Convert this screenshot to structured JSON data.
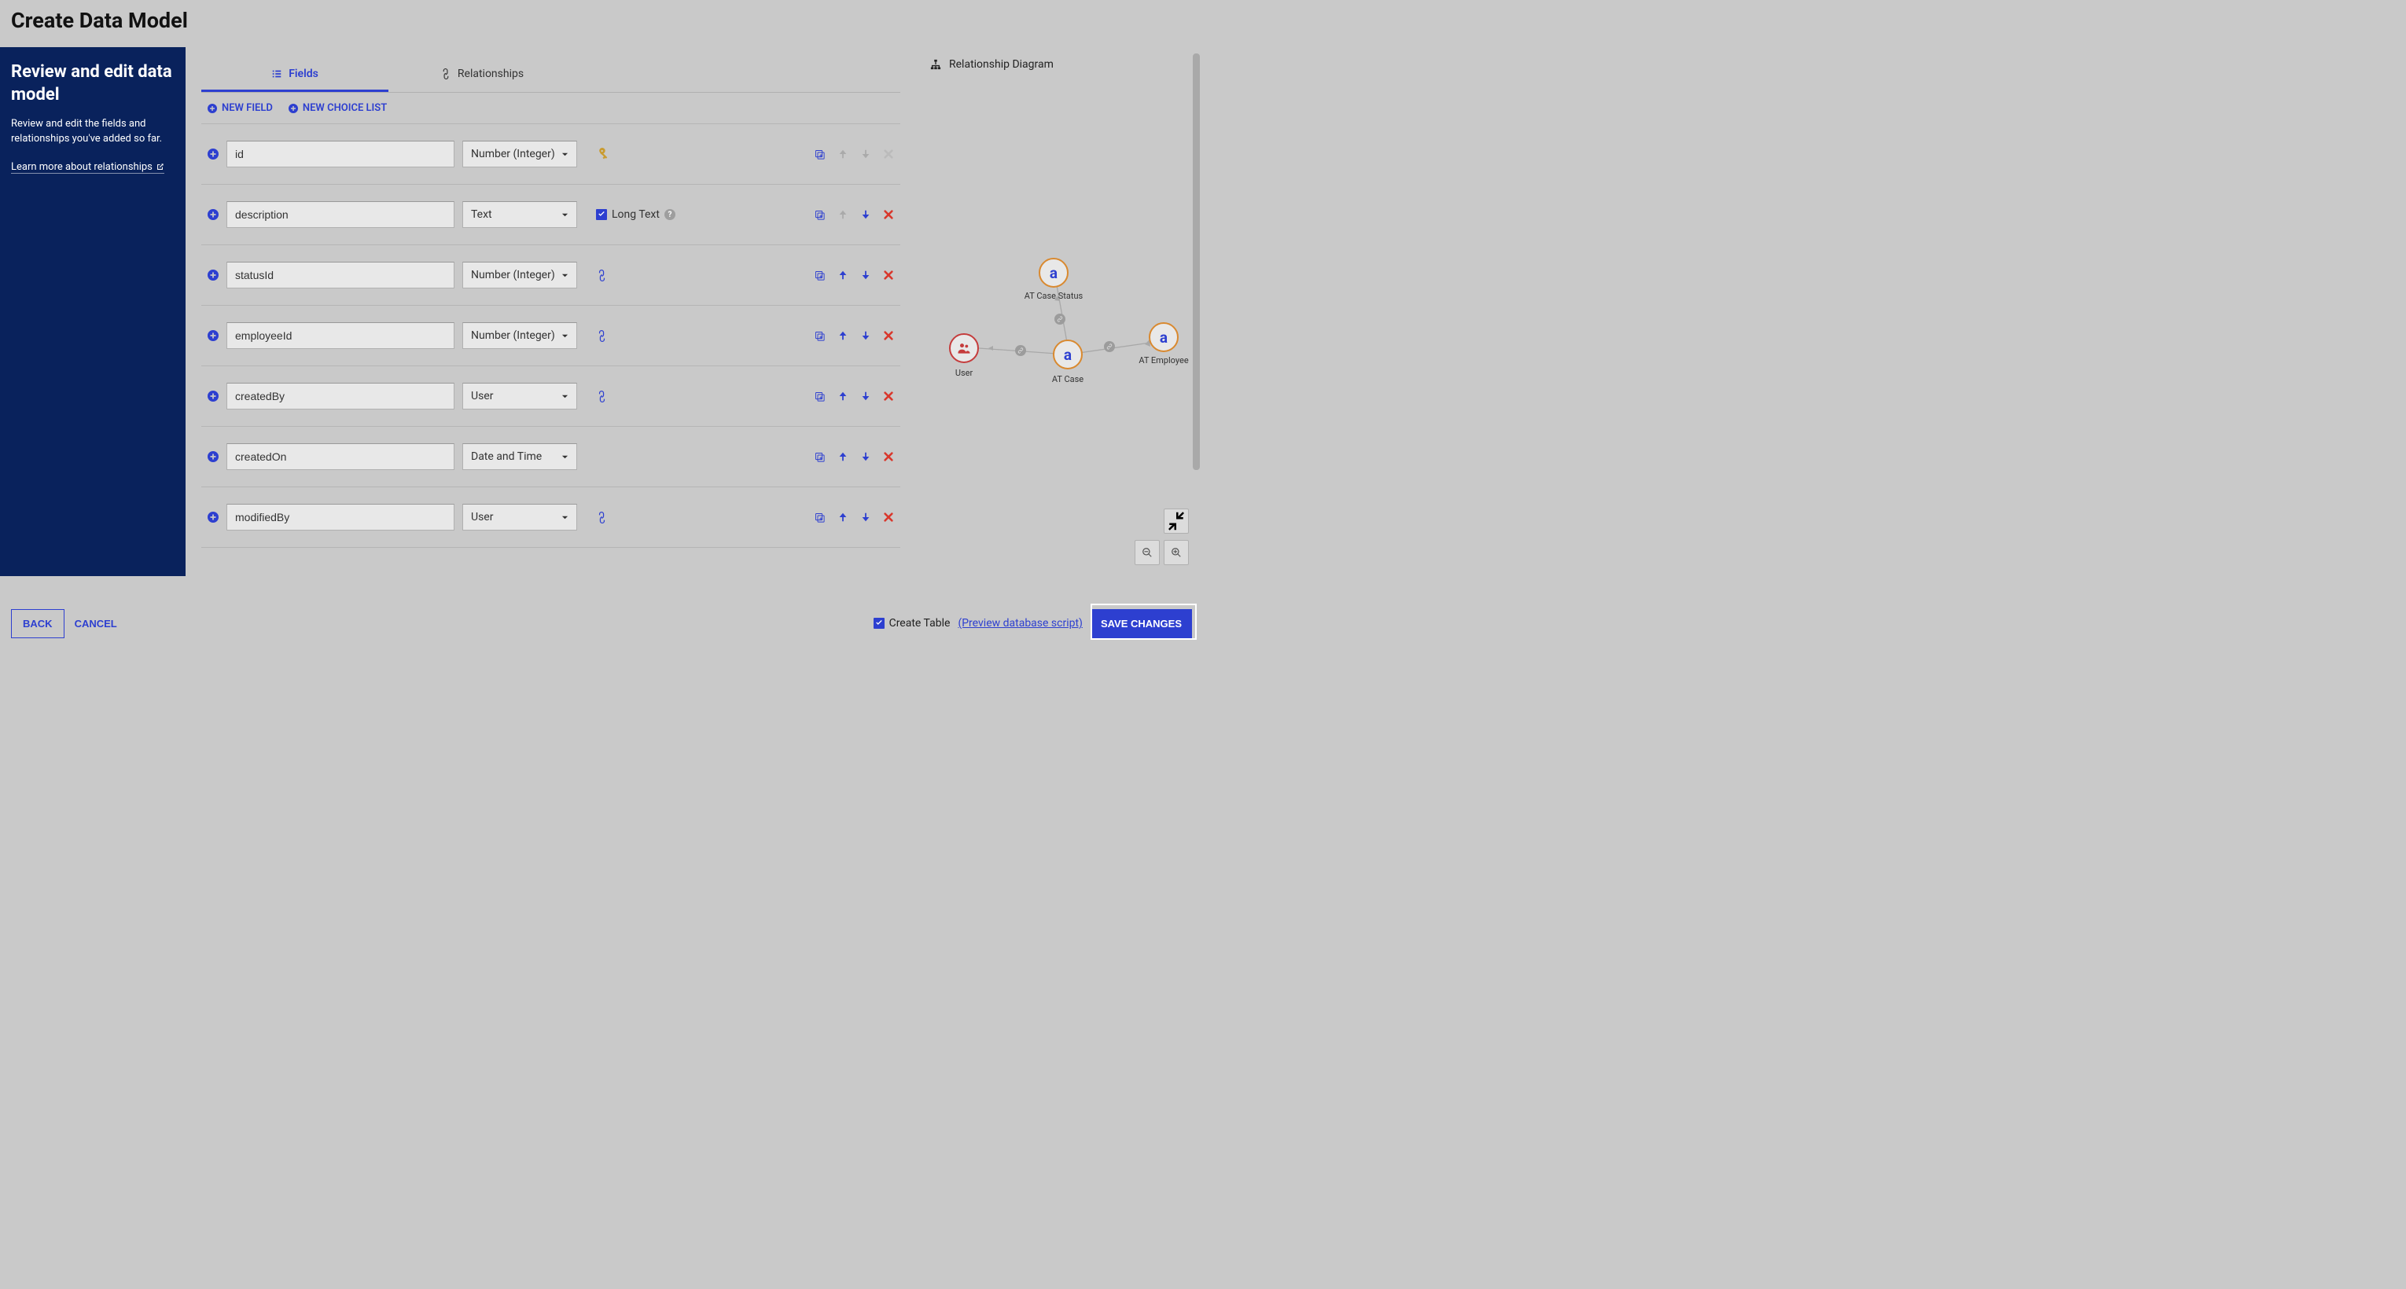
{
  "header": {
    "title": "Create Data Model"
  },
  "sidebar": {
    "heading": "Review and edit data model",
    "description": "Review and edit the fields and relationships you've added so far.",
    "link_text": "Learn more about relationships"
  },
  "tabs": {
    "fields": "Fields",
    "relationships": "Relationships"
  },
  "actions": {
    "new_field": "NEW FIELD",
    "new_choice": "NEW CHOICE LIST"
  },
  "fields": [
    {
      "name": "id",
      "type": "Number (Integer)",
      "extra": null,
      "link": false,
      "key": true,
      "up": false,
      "down": false,
      "delete": false
    },
    {
      "name": "description",
      "type": "Text",
      "extra": "Long Text",
      "link": false,
      "key": false,
      "up": false,
      "down": true,
      "delete": true
    },
    {
      "name": "statusId",
      "type": "Number (Integer)",
      "extra": null,
      "link": true,
      "key": false,
      "up": true,
      "down": true,
      "delete": true
    },
    {
      "name": "employeeId",
      "type": "Number (Integer)",
      "extra": null,
      "link": true,
      "key": false,
      "up": true,
      "down": true,
      "delete": true
    },
    {
      "name": "createdBy",
      "type": "User",
      "extra": null,
      "link": true,
      "key": false,
      "up": true,
      "down": true,
      "delete": true
    },
    {
      "name": "createdOn",
      "type": "Date and Time",
      "extra": null,
      "link": false,
      "key": false,
      "up": true,
      "down": true,
      "delete": true
    },
    {
      "name": "modifiedBy",
      "type": "User",
      "extra": null,
      "link": true,
      "key": false,
      "up": true,
      "down": true,
      "delete": true
    }
  ],
  "diagram": {
    "heading": "Relationship Diagram",
    "nodes": {
      "user": "User",
      "case": "AT Case",
      "status": "AT Case Status",
      "employee": "AT Employee"
    }
  },
  "footer": {
    "back": "BACK",
    "cancel": "CANCEL",
    "create_table": "Create Table",
    "preview": "(Preview database script)",
    "save": "SAVE CHANGES"
  }
}
